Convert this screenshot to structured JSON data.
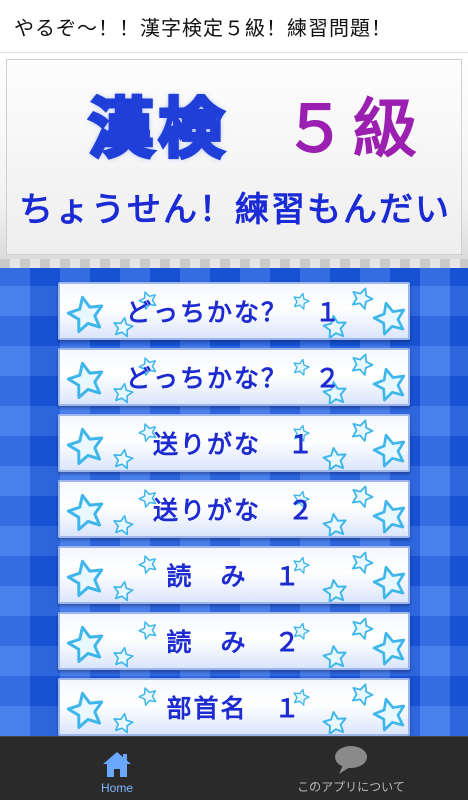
{
  "app": {
    "title": "やるぞ～！！漢字検定５級！練習問題！"
  },
  "header": {
    "title_main": "漢検",
    "title_grade": "５級",
    "subtitle": "ちょうせん！練習もんだい"
  },
  "menu": [
    {
      "label": "どっちかな？　１"
    },
    {
      "label": "どっちかな？　２"
    },
    {
      "label": "送りがな　１"
    },
    {
      "label": "送りがな　２"
    },
    {
      "label": "読　み　１"
    },
    {
      "label": "読　み　２"
    },
    {
      "label": "部首名　１"
    }
  ],
  "nav": {
    "home_label": "Home",
    "about_label": "このアプリについて",
    "home_icon": "house-icon",
    "about_icon": "speech-bubble-icon"
  },
  "colors": {
    "background_blue": "#1a5ee8",
    "button_text": "#1d2bd0",
    "grade_purple": "#9b1fb0",
    "star": "#3fb6ea"
  }
}
